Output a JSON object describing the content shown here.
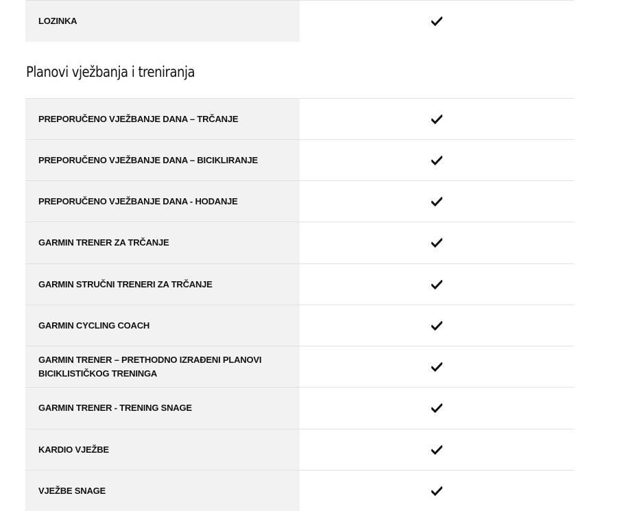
{
  "top_table": {
    "rows": [
      {
        "label": "LOZINKA",
        "value": "check"
      }
    ]
  },
  "section": {
    "title": "Planovi vježbanja i treniranja"
  },
  "main_table": {
    "rows": [
      {
        "label": "PREPORUČENO VJEŽBANJE DANA – TRČANJE",
        "value": "check"
      },
      {
        "label": "PREPORUČENO VJEŽBANJE DANA – BICIKLIRANJE",
        "value": "check"
      },
      {
        "label": "PREPORUČENO VJEŽBANJE DANA - HODANJE",
        "value": "check"
      },
      {
        "label": "GARMIN TRENER ZA TRČANJE",
        "value": "check"
      },
      {
        "label": "GARMIN STRUČNI TRENERI ZA TRČANJE",
        "value": "check"
      },
      {
        "label": "GARMIN CYCLING COACH",
        "value": "check"
      },
      {
        "label": "GARMIN TRENER – PRETHODNO IZRAĐENI PLANOVI BICIKLISTIČKOG TRENINGA",
        "value": "check"
      },
      {
        "label": "GARMIN TRENER - TRENING SNAGE",
        "value": "check"
      },
      {
        "label": "KARDIO VJEŽBE",
        "value": "check"
      },
      {
        "label": "VJEŽBE SNAGE",
        "value": "check"
      }
    ]
  },
  "icons": {
    "check": "checkmark-icon"
  },
  "colors": {
    "label_bg": "#f2f2f2",
    "divider": "#e2e2e2",
    "text": "#111111"
  }
}
